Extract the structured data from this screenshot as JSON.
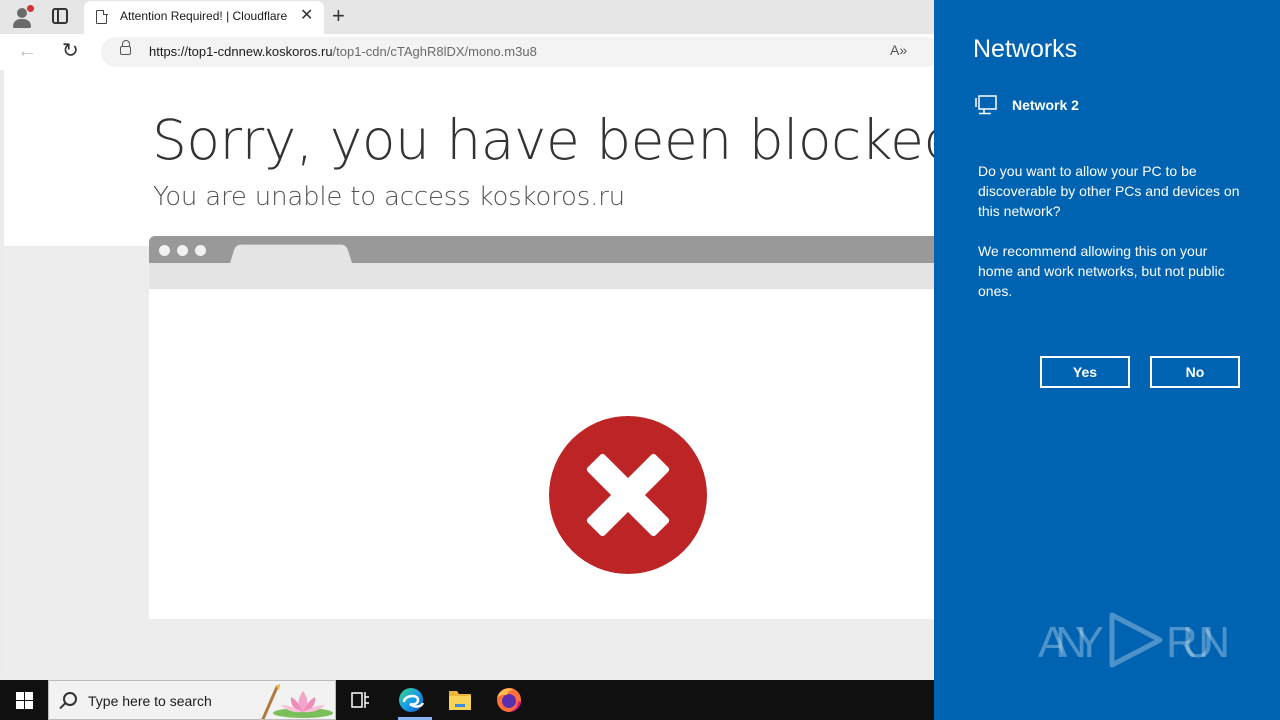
{
  "browser": {
    "tab_title": "Attention Required! | Cloudflare",
    "tab_close": "✕",
    "new_tab": "+",
    "url_domain": "https://top1-cdnnew.koskoros.ru",
    "url_path": "/top1-cdn/cTAghR8lDX/mono.m3u8",
    "back": "←",
    "reload": "↻",
    "read_aloud": "A»"
  },
  "page": {
    "heading": "Sorry, you have been blocked",
    "subheading": "You are unable to access koskoros.ru"
  },
  "flyout": {
    "title": "Networks",
    "network_name": "Network 2",
    "question": "Do you want to allow your PC to be discoverable by other PCs and devices on this network?",
    "recommendation": "We recommend allowing this on your home and work networks, but not public ones.",
    "yes_label": "Yes",
    "no_label": "No",
    "watermark": "ANY RUN"
  },
  "taskbar": {
    "search_placeholder": "Type here to search",
    "pinned": [
      "task-view",
      "edge",
      "file-explorer",
      "firefox"
    ]
  },
  "colors": {
    "flyout_bg": "#0063b1",
    "blocked_red": "#bd2426",
    "taskbar_bg": "#101010"
  }
}
